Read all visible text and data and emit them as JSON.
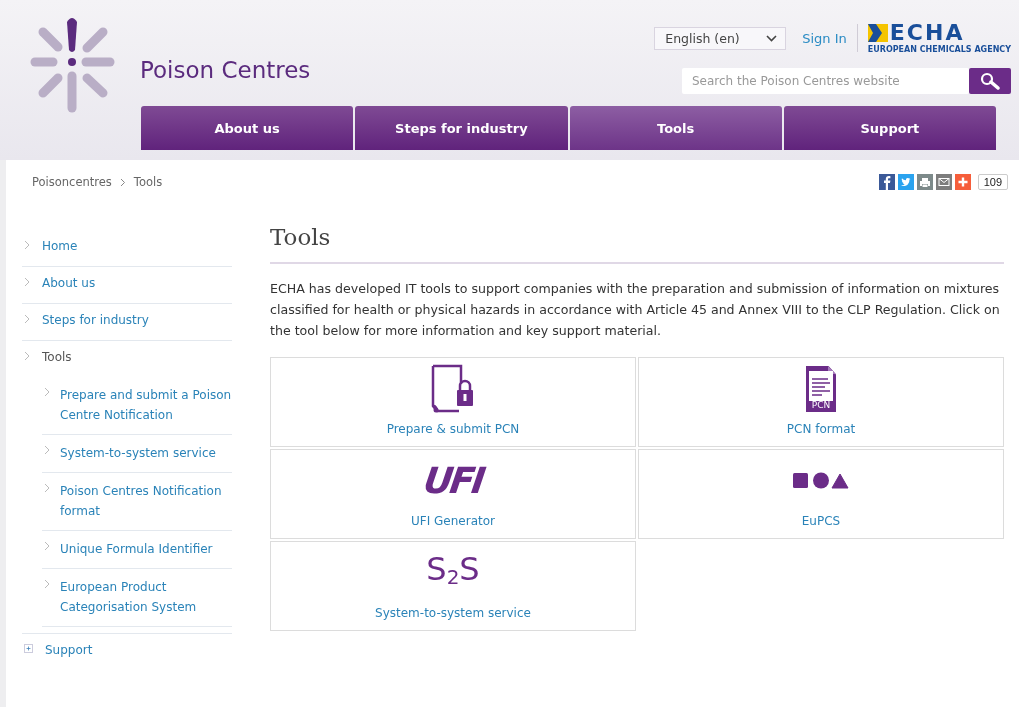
{
  "header": {
    "site_title": "Poison Centres",
    "language": "English (en)",
    "sign_in": "Sign In",
    "logo": {
      "name": "ECHA",
      "subtitle": "EUROPEAN CHEMICALS AGENCY"
    },
    "search": {
      "placeholder": "Search the Poison Centres website"
    }
  },
  "nav": [
    {
      "label": "About us",
      "selected": false
    },
    {
      "label": "Steps for industry",
      "selected": false
    },
    {
      "label": "Tools",
      "selected": true
    },
    {
      "label": "Support",
      "selected": false
    }
  ],
  "breadcrumb": [
    "Poisoncentres",
    "Tools"
  ],
  "share": {
    "count": "109"
  },
  "sidebar": [
    {
      "label": "Home",
      "kind": "link",
      "selected": false
    },
    {
      "label": "About us",
      "kind": "link",
      "selected": false
    },
    {
      "label": "Steps for industry",
      "kind": "link",
      "selected": false
    },
    {
      "label": "Tools",
      "kind": "link",
      "selected": true,
      "children": [
        {
          "label": "Prepare and submit a Poison Centre Notification",
          "selected": false
        },
        {
          "label": "System-to-system service",
          "selected": false
        },
        {
          "label": "Poison Centres Notification format",
          "selected": false
        },
        {
          "label": "Unique Formula Identifier",
          "selected": false
        },
        {
          "label": "European Product Categorisation System",
          "selected": false
        }
      ]
    },
    {
      "label": "Support",
      "kind": "expandable",
      "selected": false
    }
  ],
  "main": {
    "heading": "Tools",
    "intro": "ECHA has developed IT tools to support companies with the preparation and submission of information on mixtures classified for health or physical hazards in accordance with Article 45 and Annex VIII to the CLP Regulation. Click on the tool below for more information and key support material.",
    "tools": [
      {
        "label": "Prepare & submit PCN",
        "kind": "lock-document"
      },
      {
        "label": "PCN format",
        "kind": "text-document",
        "icon_text": "PCN"
      },
      {
        "label": "UFI Generator",
        "kind": "wordmark",
        "icon_text": "UFI"
      },
      {
        "label": "EuPCS",
        "kind": "shapes"
      },
      {
        "label": "System-to-system service",
        "kind": "wordmark-sub",
        "icon_text": "S$_{2}$S"
      }
    ]
  }
}
